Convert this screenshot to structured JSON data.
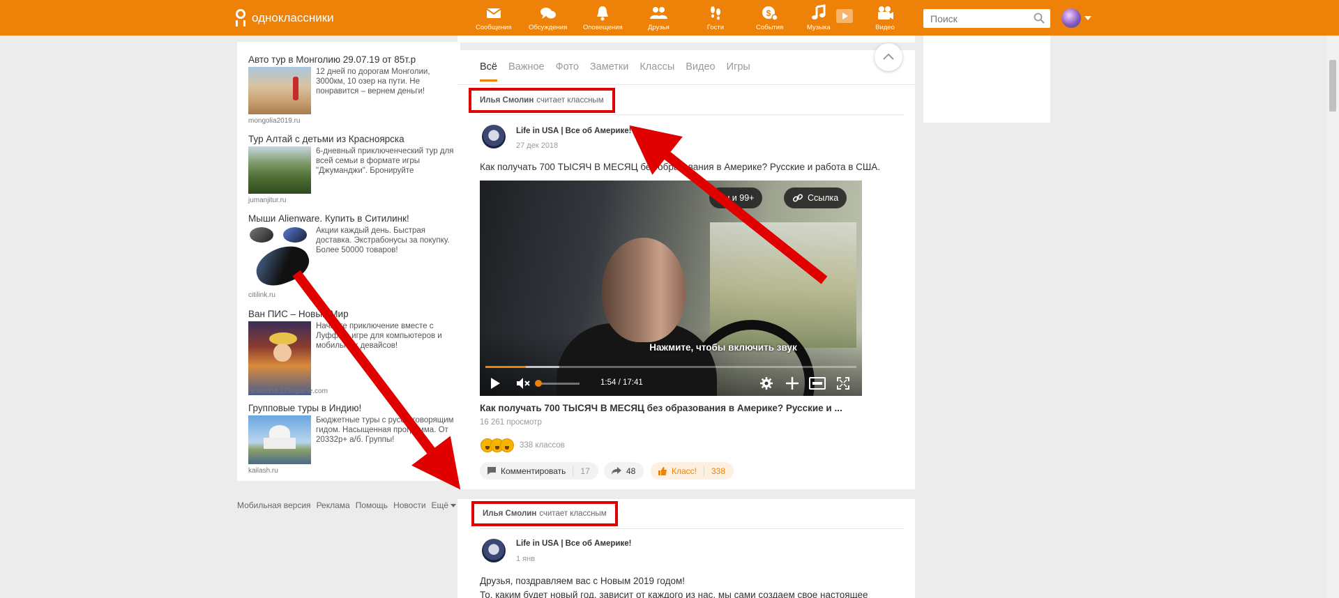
{
  "header": {
    "logo_text": "одноклассники",
    "brand_color": "#ee8208",
    "nav": [
      {
        "label": "Сообщения",
        "icon": "envelope-icon"
      },
      {
        "label": "Обсуждения",
        "icon": "chat-bubbles-icon"
      },
      {
        "label": "Оповещения",
        "icon": "bell-icon"
      },
      {
        "label": "Друзья",
        "icon": "friends-icon"
      },
      {
        "label": "Гости",
        "icon": "footprints-icon"
      },
      {
        "label": "События",
        "icon": "events-icon"
      },
      {
        "label": "Музыка",
        "icon": "music-note-icon"
      },
      {
        "label": "Видео",
        "icon": "video-camera-icon"
      }
    ],
    "search_placeholder": "Поиск"
  },
  "ads": [
    {
      "title": "Авто тур в Монголию 29.07.19 от 85т.р",
      "desc": "12 дней по дорогам Монголии, 3000км, 10 озер на пути. Не понравится – вернем деньги!",
      "domain": "mongolia2019.ru"
    },
    {
      "title": "Тур Алтай с детьми из Красноярска",
      "desc": "6-дневный приключенческий тур для всей семьи в формате игры \"Джуманджи\". Бронируйте",
      "domain": "jumanjitur.ru"
    },
    {
      "title": "Мыши Alienware. Купить в Ситилинк!",
      "desc": "Акции каждый день. Быстрая доставка. Экстрабонусы за покупку. Более 50000 товаров!",
      "domain": "citilink.ru"
    },
    {
      "title": "Ван ПИС – Новый Мир",
      "desc": "Начните приключение вместе с Луффи в игре для компьютеров и мобильных девайсов!",
      "domain": "newworld.123ogame.com"
    },
    {
      "title": "Групповые туры в Индию!",
      "desc": "Бюджетные туры с русскоговорящим гидом. Насыщенная программа. От 20332р+ а/б. Группы!",
      "domain": "kailash.ru"
    }
  ],
  "footer_links": [
    "Мобильная версия",
    "Реклама",
    "Помощь",
    "Новости",
    "Ещё"
  ],
  "feed": {
    "tabs": [
      "Всё",
      "Важное",
      "Фото",
      "Заметки",
      "Классы",
      "Видео",
      "Игры"
    ],
    "active_tab": "Всё",
    "post1": {
      "liked_by": "Илья Смолин",
      "liked_text": "считает классным",
      "author": "Life in USA",
      "group": "Все об Америке!",
      "date": "27 дек 2018",
      "text": "Как получать 700 ТЫСЯЧ В МЕСЯЦ без образования в Америке? Русские и работа в США.",
      "video": {
        "pill_likes": "Вы и 99+",
        "pill_link": "Ссылка",
        "caption": "Нажмите, чтобы включить звук",
        "time": "1:54 / 17:41",
        "progress": 0.109
      },
      "title": "Как получать 700 ТЫСЯЧ В МЕСЯЦ без образования в Америке? Русские и ...",
      "views": "16 261 просмотр",
      "reactions_count": "338 классов",
      "comment_label": "Комментировать",
      "comment_count": "17",
      "share_count": "48",
      "klass_label": "Класс!",
      "klass_count": "338"
    },
    "post2": {
      "liked_by": "Илья Смолин",
      "liked_text": "считает классным",
      "author": "Life in USA",
      "group": "Все об Америке!",
      "date": "1 янв",
      "text_line1": "Друзья, поздравляем вас с Новым 2019 годом!",
      "text_line2": "То, каким будет новый год, зависит от каждого из нас, мы сами создаем свое настоящее"
    }
  },
  "annotation_color": "#e00000"
}
